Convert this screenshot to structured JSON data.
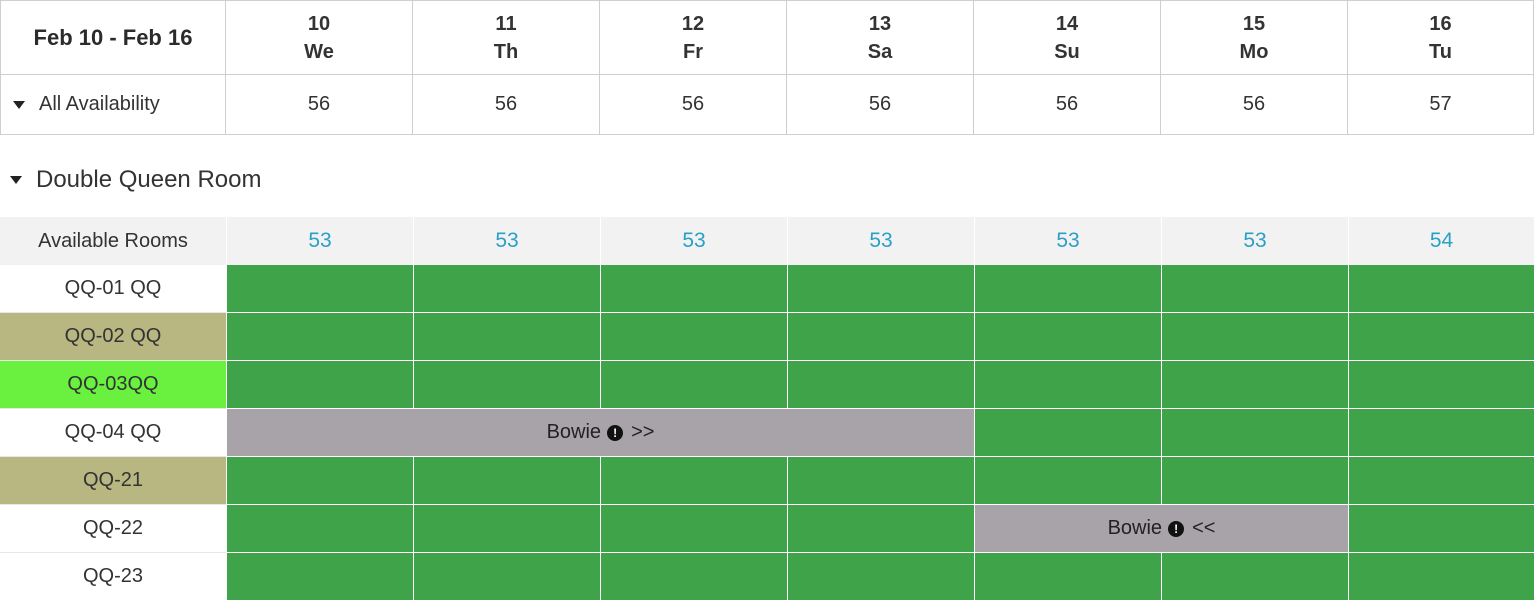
{
  "header": {
    "range": "Feb 10 - Feb 16",
    "days": [
      {
        "num": "10",
        "dow": "We"
      },
      {
        "num": "11",
        "dow": "Th"
      },
      {
        "num": "12",
        "dow": "Fr"
      },
      {
        "num": "13",
        "dow": "Sa"
      },
      {
        "num": "14",
        "dow": "Su"
      },
      {
        "num": "15",
        "dow": "Mo"
      },
      {
        "num": "16",
        "dow": "Tu"
      }
    ]
  },
  "all_availability": {
    "label": "All Availability",
    "values": [
      "56",
      "56",
      "56",
      "56",
      "56",
      "56",
      "57"
    ]
  },
  "section": {
    "title": "Double Queen Room",
    "available_rooms_label": "Available Rooms",
    "available_rooms_values": [
      "53",
      "53",
      "53",
      "53",
      "53",
      "53",
      "54"
    ]
  },
  "rooms": [
    {
      "label": "QQ-01 QQ"
    },
    {
      "label": "QQ-02 QQ"
    },
    {
      "label": "QQ-03QQ"
    },
    {
      "label": "QQ-04 QQ"
    },
    {
      "label": "QQ-21"
    },
    {
      "label": "QQ-22"
    },
    {
      "label": "QQ-23"
    }
  ],
  "bookings": [
    {
      "guest": "Bowie",
      "warn_icon": "!",
      "arrow": ">>"
    },
    {
      "guest": "Bowie",
      "warn_icon": "!",
      "arrow": "<<"
    }
  ],
  "colors": {
    "available": "#3fa34a",
    "booked": "#a7a3a8",
    "room_tan": "#b8b681",
    "room_green": "#6af03f",
    "count_accent": "#2aa0c6"
  }
}
